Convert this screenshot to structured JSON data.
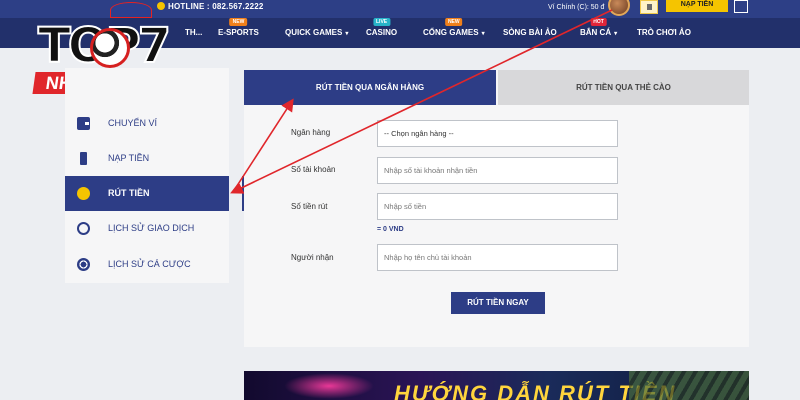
{
  "header": {
    "hotline": "HOTLINE : 082.567.2222",
    "wallet": "Ví Chính (C): 50 đ",
    "deposit_button": "NẠP TIỀN"
  },
  "nav": {
    "items": [
      {
        "label": "TH...",
        "has_caret": false,
        "badge": ""
      },
      {
        "label": "E-SPORTS",
        "has_caret": false,
        "badge": "NEW"
      },
      {
        "label": "QUICK GAMES",
        "has_caret": true,
        "badge": ""
      },
      {
        "label": "CASINO",
        "has_caret": false,
        "badge": "LIVE"
      },
      {
        "label": "CỔNG GAMES",
        "has_caret": true,
        "badge": "NEW"
      },
      {
        "label": "SÒNG BÀI ẢO",
        "has_caret": false,
        "badge": ""
      },
      {
        "label": "BẮN CÁ",
        "has_caret": true,
        "badge": "HOT"
      },
      {
        "label": "TRÒ CHƠI ẢO",
        "has_caret": false,
        "badge": ""
      }
    ],
    "badge_colors": {
      "NEW": "#f0801a",
      "LIVE": "#27b3c9",
      "HOT": "#e0253a"
    }
  },
  "logo": {
    "word": "TOP7",
    "subtitle": "NHACAI.SOLAR"
  },
  "sidebar": {
    "items": [
      {
        "label": "CHUYỂN VÍ",
        "icon": "wallet-icon",
        "active": false
      },
      {
        "label": "NẠP TIỀN",
        "icon": "phone-icon",
        "active": false
      },
      {
        "label": "RÚT TIỀN",
        "icon": "coin-icon",
        "active": true
      },
      {
        "label": "LỊCH SỬ GIAO DỊCH",
        "icon": "history-icon",
        "active": false
      },
      {
        "label": "LỊCH SỬ CÁ CƯỢC",
        "icon": "soccer-ball-icon",
        "active": false
      }
    ]
  },
  "tabs": {
    "bank": "RÚT TIỀN QUA NGÂN HÀNG",
    "card": "RÚT TIỀN QUA THẺ CÀO"
  },
  "form": {
    "bank_label": "Ngân hàng",
    "bank_select": "-- Chọn ngân hàng --",
    "account_label": "Số tài khoản",
    "account_placeholder": "Nhập số tài khoản nhận tiền",
    "amount_label": "Số tiền rút",
    "amount_placeholder": "Nhập số tiền",
    "amount_value": "= 0 VND",
    "recipient_label": "Người nhận",
    "recipient_placeholder": "Nhập họ tên chủ tài khoản",
    "submit": "RÚT TIỀN NGAY"
  },
  "banner": {
    "text": "HƯỚNG DẪN RÚT TIỀN"
  },
  "colors": {
    "primary": "#2d3d86",
    "accent": "#f5c400",
    "annotation_red": "#e0262b"
  }
}
